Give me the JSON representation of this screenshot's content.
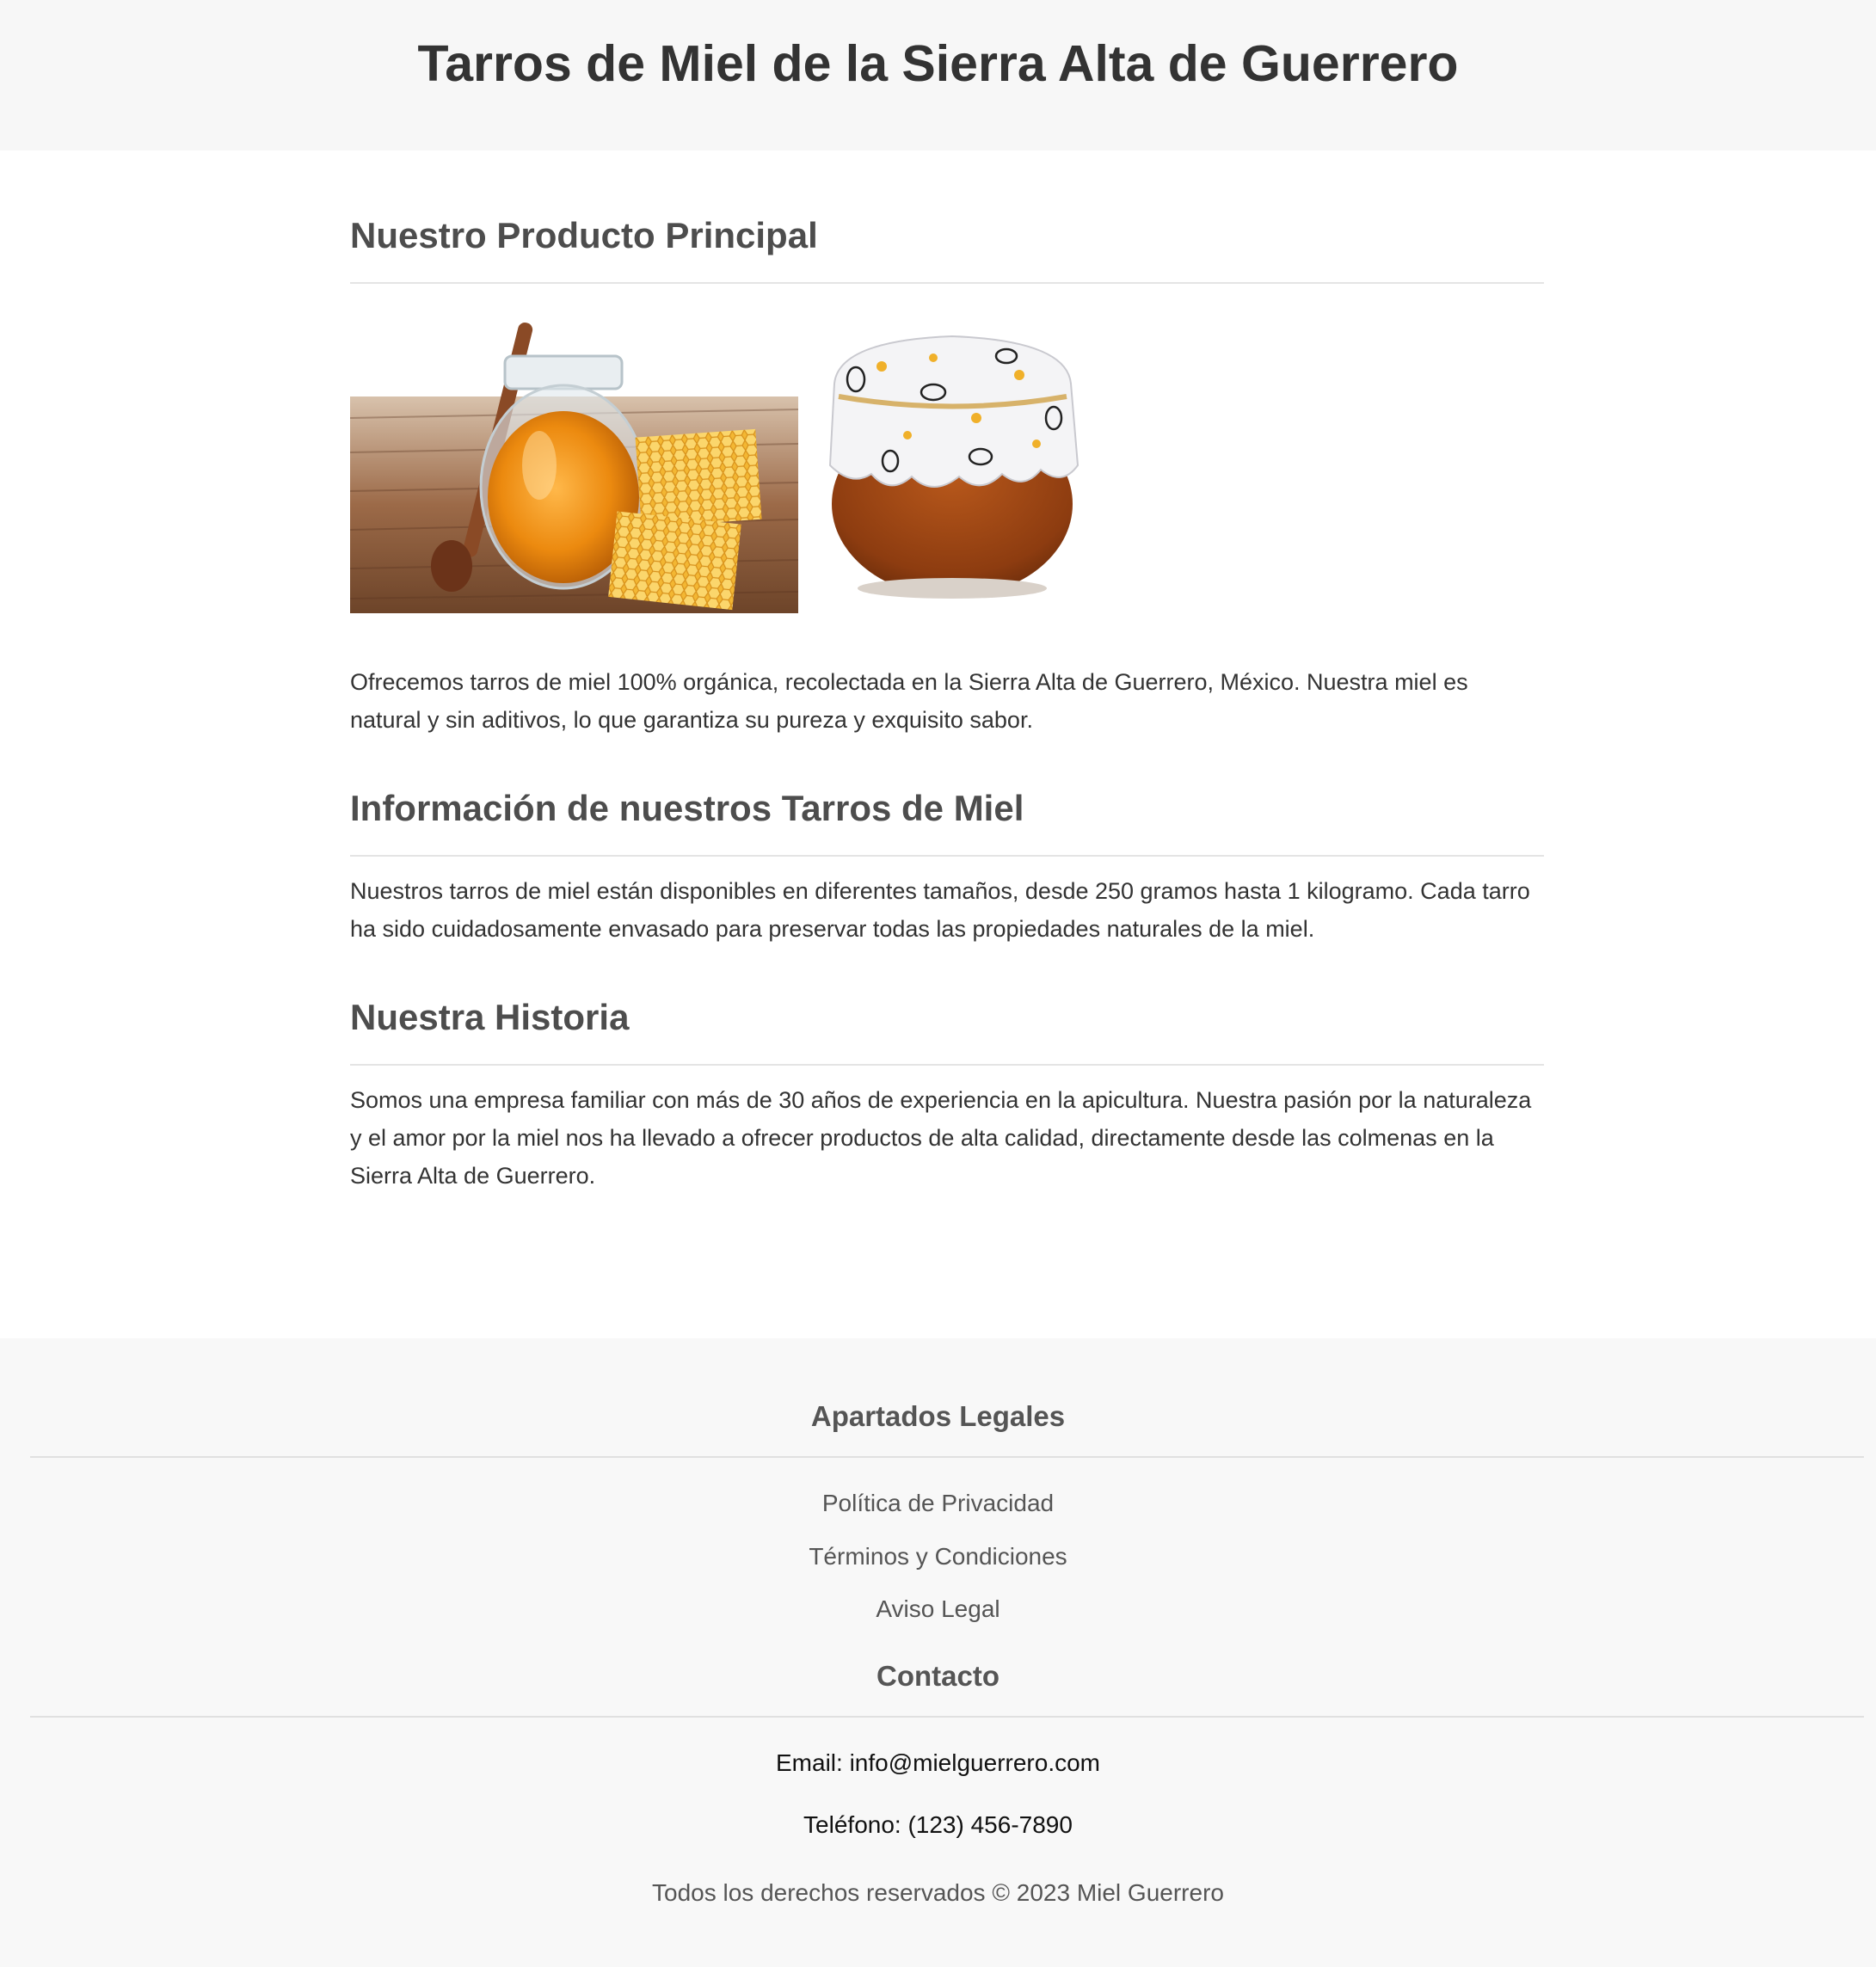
{
  "header": {
    "title": "Tarros de Miel de la Sierra Alta de Guerrero"
  },
  "product": {
    "heading": "Nuestro Producto Principal",
    "description": "Ofrecemos tarros de miel 100% orgánica, recolectada en la Sierra Alta de Guerrero, México. Nuestra miel es natural y sin aditivos, lo que garantiza su pureza y exquisito sabor."
  },
  "info": {
    "heading": "Información de nuestros Tarros de Miel",
    "text": "Nuestros tarros de miel están disponibles en diferentes tamaños, desde 250 gramos hasta 1 kilogramo. Cada tarro ha sido cuidadosamente envasado para preservar todas las propiedades naturales de la miel."
  },
  "history": {
    "heading": "Nuestra Historia",
    "text": "Somos una empresa familiar con más de 30 años de experiencia en la apicultura. Nuestra pasión por la naturaleza y el amor por la miel nos ha llevado a ofrecer productos de alta calidad, directamente desde las colmenas en la Sierra Alta de Guerrero."
  },
  "footer": {
    "legal_heading": "Apartados Legales",
    "links": [
      "Política de Privacidad",
      "Términos y Condiciones",
      "Aviso Legal"
    ],
    "contact_heading": "Contacto",
    "email": "Email: info@mielguerrero.com",
    "phone": "Teléfono: (123) 456-7890",
    "copyright": "Todos los derechos reservados © 2023 Miel Guerrero"
  },
  "colors": {
    "header_bg": "#f7f7f7",
    "footer_bg": "#f8f8f8",
    "heading_text": "#4d4d4d",
    "honey": "#e8890c"
  }
}
